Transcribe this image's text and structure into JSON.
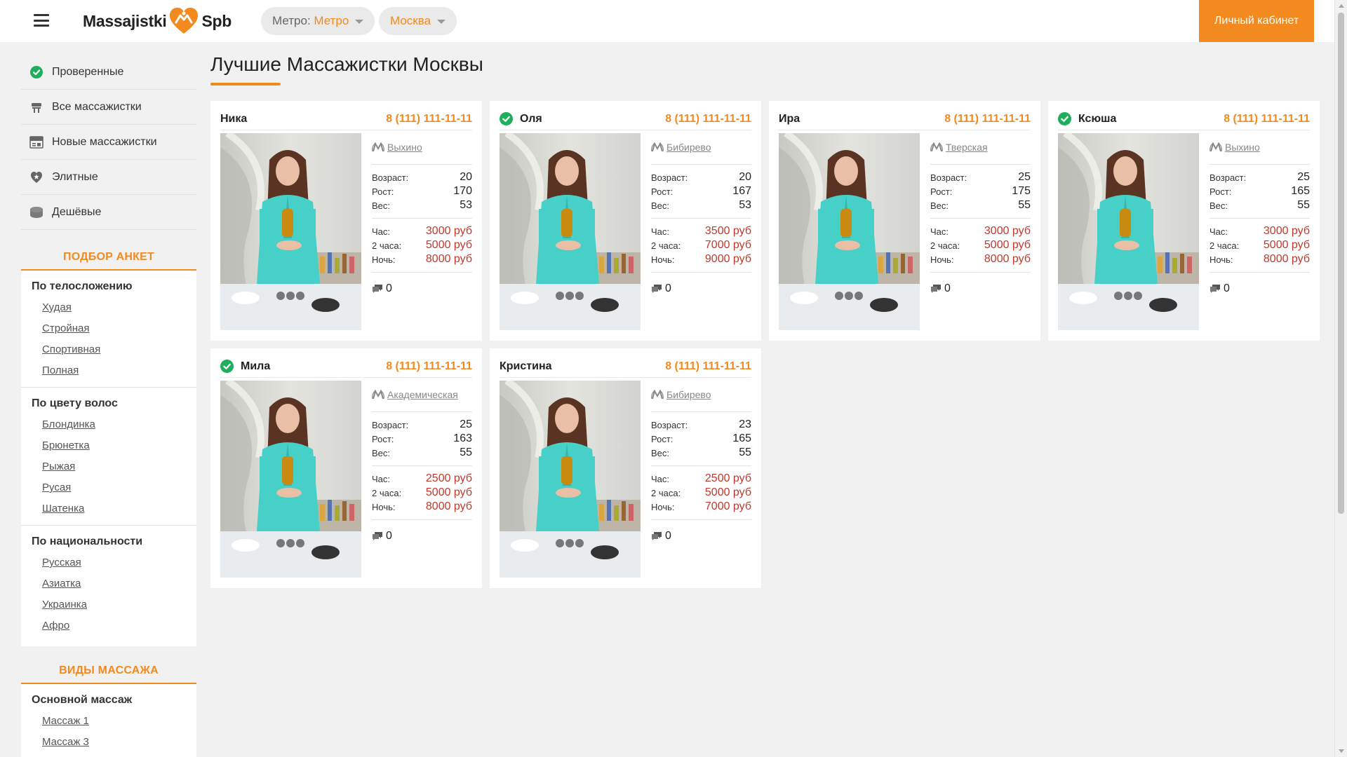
{
  "header": {
    "logo_left": "Massajistki",
    "logo_right": "Spb",
    "metro_label": "Метро: ",
    "metro_value": "Метро",
    "city": "Москва",
    "cabinet": "Личный кабинет"
  },
  "sidebar": {
    "links": [
      {
        "label": "Проверенные",
        "icon": "check-circle-icon"
      },
      {
        "label": "Все массажистки",
        "icon": "massage-table-icon"
      },
      {
        "label": "Новые массажистки",
        "icon": "new-badge-icon"
      },
      {
        "label": "Элитные",
        "icon": "elite-star-icon"
      },
      {
        "label": "Дешёвые",
        "icon": "coins-icon"
      }
    ],
    "filters_title": "ПОДБОР АНКЕТ",
    "filters": [
      {
        "head": "По телосложению",
        "items": [
          "Худая",
          "Стройная",
          "Спортивная",
          "Полная"
        ]
      },
      {
        "head": "По цвету волос",
        "items": [
          "Блондинка",
          "Брюнетка",
          "Рыжая",
          "Русая",
          "Шатенка"
        ]
      },
      {
        "head": "По национальности",
        "items": [
          "Русская",
          "Азиатка",
          "Украинка",
          "Афро"
        ]
      }
    ],
    "massage_title": "ВИДЫ МАССАЖА",
    "massage": {
      "head": "Основной массаж",
      "items": [
        "Массаж 1",
        "Массаж 3"
      ]
    }
  },
  "main": {
    "title": "Лучшие Массажистки Москвы",
    "labels": {
      "age": "Возраст:",
      "height": "Рост:",
      "weight": "Вес:",
      "hour": "Час:",
      "two_hours": "2 часа:",
      "night": "Ночь:"
    },
    "cards": [
      {
        "name": "Ника",
        "verified": false,
        "phone": "8 (111) 111-11-11",
        "metro": "Выхино",
        "age": "20",
        "height": "170",
        "weight": "53",
        "hour": "3000 руб",
        "two_hours": "5000 руб",
        "night": "8000 руб",
        "comments": "0"
      },
      {
        "name": "Оля",
        "verified": true,
        "phone": "8 (111) 111-11-11",
        "metro": "Бибирево",
        "age": "20",
        "height": "167",
        "weight": "53",
        "hour": "3500 руб",
        "two_hours": "7000 руб",
        "night": "9000 руб",
        "comments": "0"
      },
      {
        "name": "Ира",
        "verified": false,
        "phone": "8 (111) 111-11-11",
        "metro": "Тверская",
        "age": "25",
        "height": "175",
        "weight": "55",
        "hour": "3000 руб",
        "two_hours": "5000 руб",
        "night": "8000 руб",
        "comments": "0"
      },
      {
        "name": "Ксюша",
        "verified": true,
        "phone": "8 (111) 111-11-11",
        "metro": "Выхино",
        "age": "25",
        "height": "165",
        "weight": "55",
        "hour": "3000 руб",
        "two_hours": "5000 руб",
        "night": "8000 руб",
        "comments": "0"
      },
      {
        "name": "Мила",
        "verified": true,
        "phone": "8 (111) 111-11-11",
        "metro": "Академическая",
        "age": "25",
        "height": "163",
        "weight": "55",
        "hour": "2500 руб",
        "two_hours": "5000 руб",
        "night": "8000 руб",
        "comments": "0"
      },
      {
        "name": "Кристина",
        "verified": false,
        "phone": "8 (111) 111-11-11",
        "metro": "Бибирево",
        "age": "23",
        "height": "165",
        "weight": "55",
        "hour": "2500 руб",
        "two_hours": "5000 руб",
        "night": "7000 руб",
        "comments": "0"
      }
    ]
  },
  "colors": {
    "accent": "#f28a1f",
    "price": "#c0392b",
    "verified": "#1fae5b"
  }
}
